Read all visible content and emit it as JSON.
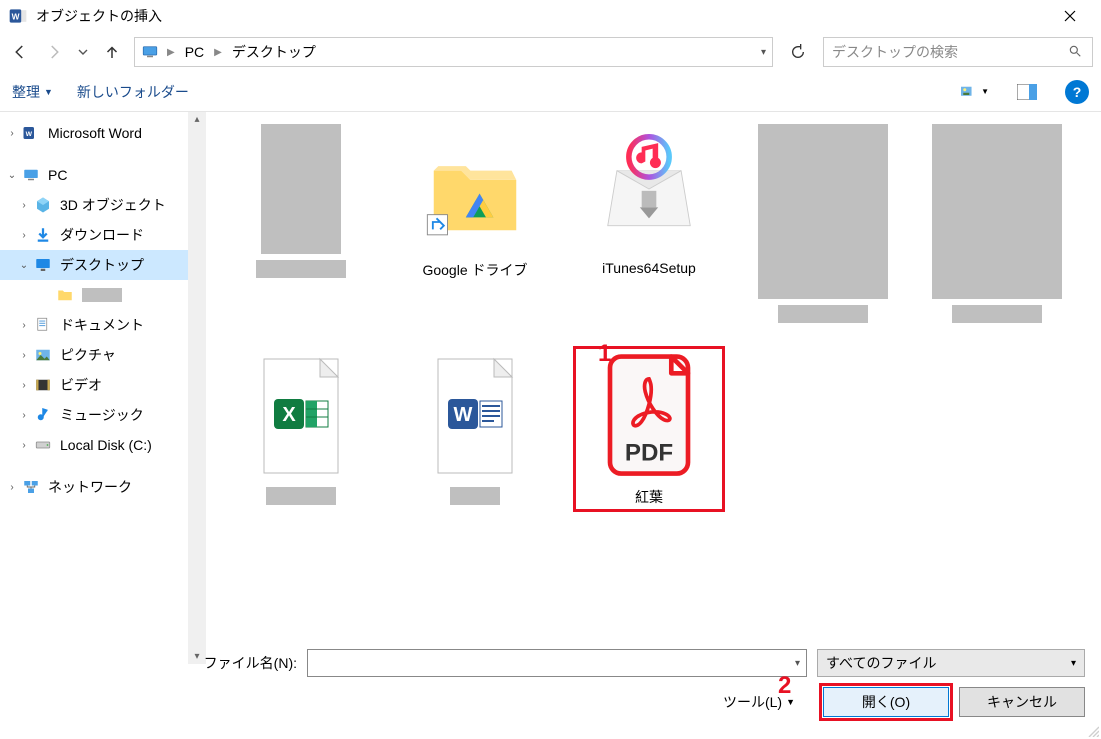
{
  "window": {
    "title": "オブジェクトの挿入"
  },
  "breadcrumbs": {
    "root": "PC",
    "current": "デスクトップ"
  },
  "search": {
    "placeholder": "デスクトップの検索"
  },
  "toolbar": {
    "organize": "整理",
    "newfolder": "新しいフォルダー"
  },
  "tree": {
    "word": "Microsoft Word",
    "pc": "PC",
    "objects3d": "3D オブジェクト",
    "downloads": "ダウンロード",
    "desktop": "デスクトップ",
    "hidden_folder": "",
    "documents": "ドキュメント",
    "pictures": "ピクチャ",
    "videos": "ビデオ",
    "music": "ミュージック",
    "localdisk": "Local Disk (C:)",
    "network": "ネットワーク"
  },
  "files": {
    "gdrive": "Google ドライブ",
    "itunes": "iTunes64Setup",
    "pdf": "紅葉",
    "excel": "",
    "wordfile": ""
  },
  "bottom": {
    "filename_label": "ファイル名(N):",
    "filter": "すべてのファイル",
    "tools": "ツール(L)",
    "open": "開く(O)",
    "cancel": "キャンセル"
  },
  "annot": {
    "one": "1",
    "two": "2"
  }
}
